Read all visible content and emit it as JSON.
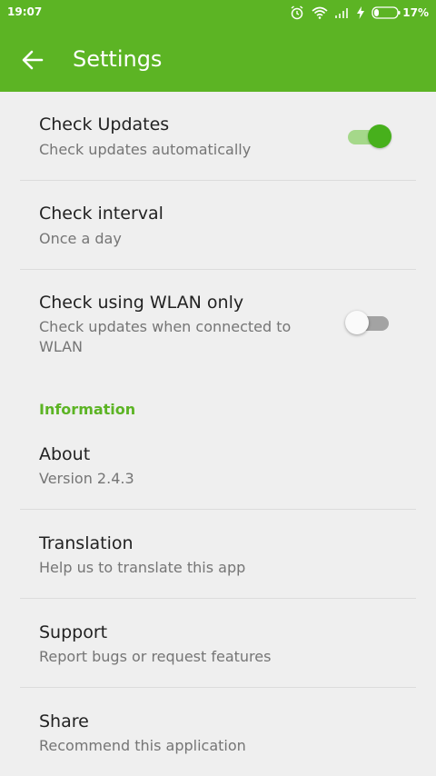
{
  "status_bar": {
    "time": "19:07",
    "battery_percent": "17%",
    "icons": [
      "alarm-icon",
      "wifi-icon",
      "signal-icon",
      "charging-icon",
      "battery-icon"
    ]
  },
  "app_bar": {
    "title": "Settings",
    "back_icon": "arrow-back-icon",
    "color": "#5cb424"
  },
  "preferences": {
    "check_updates": {
      "title": "Check Updates",
      "summary": "Check updates automatically",
      "enabled": true
    },
    "check_interval": {
      "title": "Check interval",
      "summary": "Once a day"
    },
    "wlan_only": {
      "title": "Check using WLAN only",
      "summary_line1": "Check updates when connected to",
      "summary_line2": "WLAN",
      "enabled": false
    }
  },
  "information": {
    "header": "Information",
    "items": [
      {
        "title": "About",
        "summary": "Version 2.4.3"
      },
      {
        "title": "Translation",
        "summary": "Help us to translate this app"
      },
      {
        "title": "Support",
        "summary": "Report bugs or request features"
      },
      {
        "title": "Share",
        "summary": "Recommend this application"
      }
    ]
  },
  "colors": {
    "accent": "#5cb424",
    "switch_on": "#47b01c",
    "background": "#efefef"
  }
}
